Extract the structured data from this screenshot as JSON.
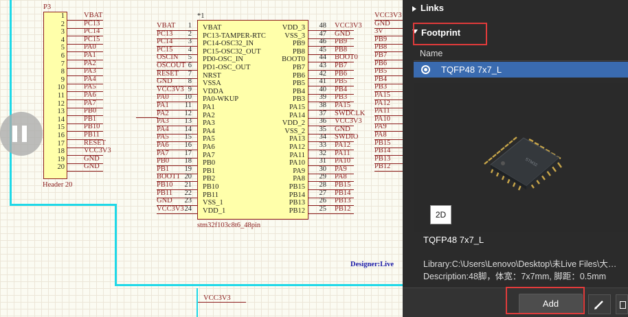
{
  "schematic": {
    "p3": {
      "ref": "P3",
      "name": "Header 20",
      "nums": [
        "1",
        "2",
        "3",
        "4",
        "5",
        "6",
        "7",
        "8",
        "9",
        "10",
        "11",
        "12",
        "13",
        "14",
        "15",
        "16",
        "17",
        "18",
        "19",
        "20"
      ],
      "nets": [
        "VBAT",
        "PC13",
        "PC14",
        "PC15",
        "PA0",
        "PA1",
        "PA2",
        "PA3",
        "PA4",
        "PA5",
        "PA6",
        "PA7",
        "PB0",
        "PB1",
        "PB10",
        "PB11",
        "RESET",
        "VCC3V3",
        "GND",
        "GND"
      ]
    },
    "mcu": {
      "ref": "*1",
      "name": "stm32f103c8t6_48pin",
      "left_nets": [
        "VBAT",
        "PC13",
        "PC14",
        "PC15",
        "OSCIN",
        "OSCOUT",
        "RESET",
        "GND",
        "VCC3V3",
        "PA0",
        "PA1",
        "PA2",
        "PA3",
        "PA4",
        "PA5",
        "PA6",
        "PA7",
        "PB0",
        "PB1",
        "BOOT1",
        "PB10",
        "PB11",
        "GND",
        "VCC3V3"
      ],
      "left_nums": [
        "1",
        "2",
        "3",
        "4",
        "5",
        "6",
        "7",
        "8",
        "9",
        "10",
        "11",
        "12",
        "13",
        "14",
        "15",
        "16",
        "17",
        "18",
        "19",
        "20",
        "21",
        "22",
        "23",
        "24"
      ],
      "left_pins": [
        "VBAT",
        "PC13-TAMPER-RTC",
        "PC14-OSC32_IN",
        "PC15-OSC32_OUT",
        "PD0-OSC_IN",
        "PD1-OSC_OUT",
        "NRST",
        "VSSA",
        "VDDA",
        "PA0-WKUP",
        "PA1",
        "PA2",
        "PA3",
        "PA4",
        "PA5",
        "PA6",
        "PA7",
        "PB0",
        "PB1",
        "PB2",
        "PB10",
        "PB11",
        "VSS_1",
        "VDD_1"
      ],
      "right_pins": [
        "VDD_3",
        "VSS_3",
        "PB9",
        "PB8",
        "BOOT0",
        "PB7",
        "PB6",
        "PB5",
        "PB4",
        "PB3",
        "PA15",
        "PA14",
        "VDD_2",
        "VSS_2",
        "PA13",
        "PA12",
        "PA11",
        "PA10",
        "PA9",
        "PA8",
        "PB15",
        "PB14",
        "PB13",
        "PB12"
      ],
      "right_nums": [
        "48",
        "47",
        "46",
        "45",
        "44",
        "43",
        "42",
        "41",
        "40",
        "39",
        "38",
        "37",
        "36",
        "35",
        "34",
        "33",
        "32",
        "31",
        "30",
        "29",
        "28",
        "27",
        "26",
        "25"
      ],
      "right_nets": [
        "VCC3V3",
        "GND",
        "PB9",
        "PB8",
        "BOOT0",
        "PB7",
        "PB6",
        "PB5",
        "PB4",
        "PB3",
        "PA15",
        "SWDCLK",
        "VCC3V3",
        "GND",
        "SWDIO",
        "PA12",
        "PA11",
        "PA10",
        "PA9",
        "PA8",
        "PB15",
        "PB14",
        "PB13",
        "PB12"
      ]
    },
    "far_right_nets": [
      "VCC3V3",
      "GND",
      "3V",
      "PB9",
      "PB8",
      "PB7",
      "PB6",
      "PB5",
      "PB4",
      "PB3",
      "PA15",
      "PA12",
      "PA11",
      "PA10",
      "PA9",
      "PA8",
      "PB15",
      "PB14",
      "PB13",
      "PB12"
    ],
    "designer": "Designer:Live",
    "bottom_net": "VCC3V3"
  },
  "panel": {
    "links_label": "Links",
    "footprint_label": "Footprint",
    "table_header": "Name",
    "footprint_row": "TQFP48 7x7_L",
    "view_mode_button": "2D",
    "footprint_title": "TQFP48 7x7_L",
    "library_label": "Library:",
    "library_value": "C:\\Users\\Lenovo\\Desktop\\未Live Files\\大…",
    "description_label": "Description:",
    "description_value": "48脚，体宽：7x7mm, 脚距：0.5mm",
    "add_button": "Add"
  },
  "colors": {
    "net": "#8a1b1b",
    "body": "#ffffaa",
    "wire": "#1ed8e8",
    "panel": "#2b2b2b",
    "highlight": "#e23b3b"
  }
}
